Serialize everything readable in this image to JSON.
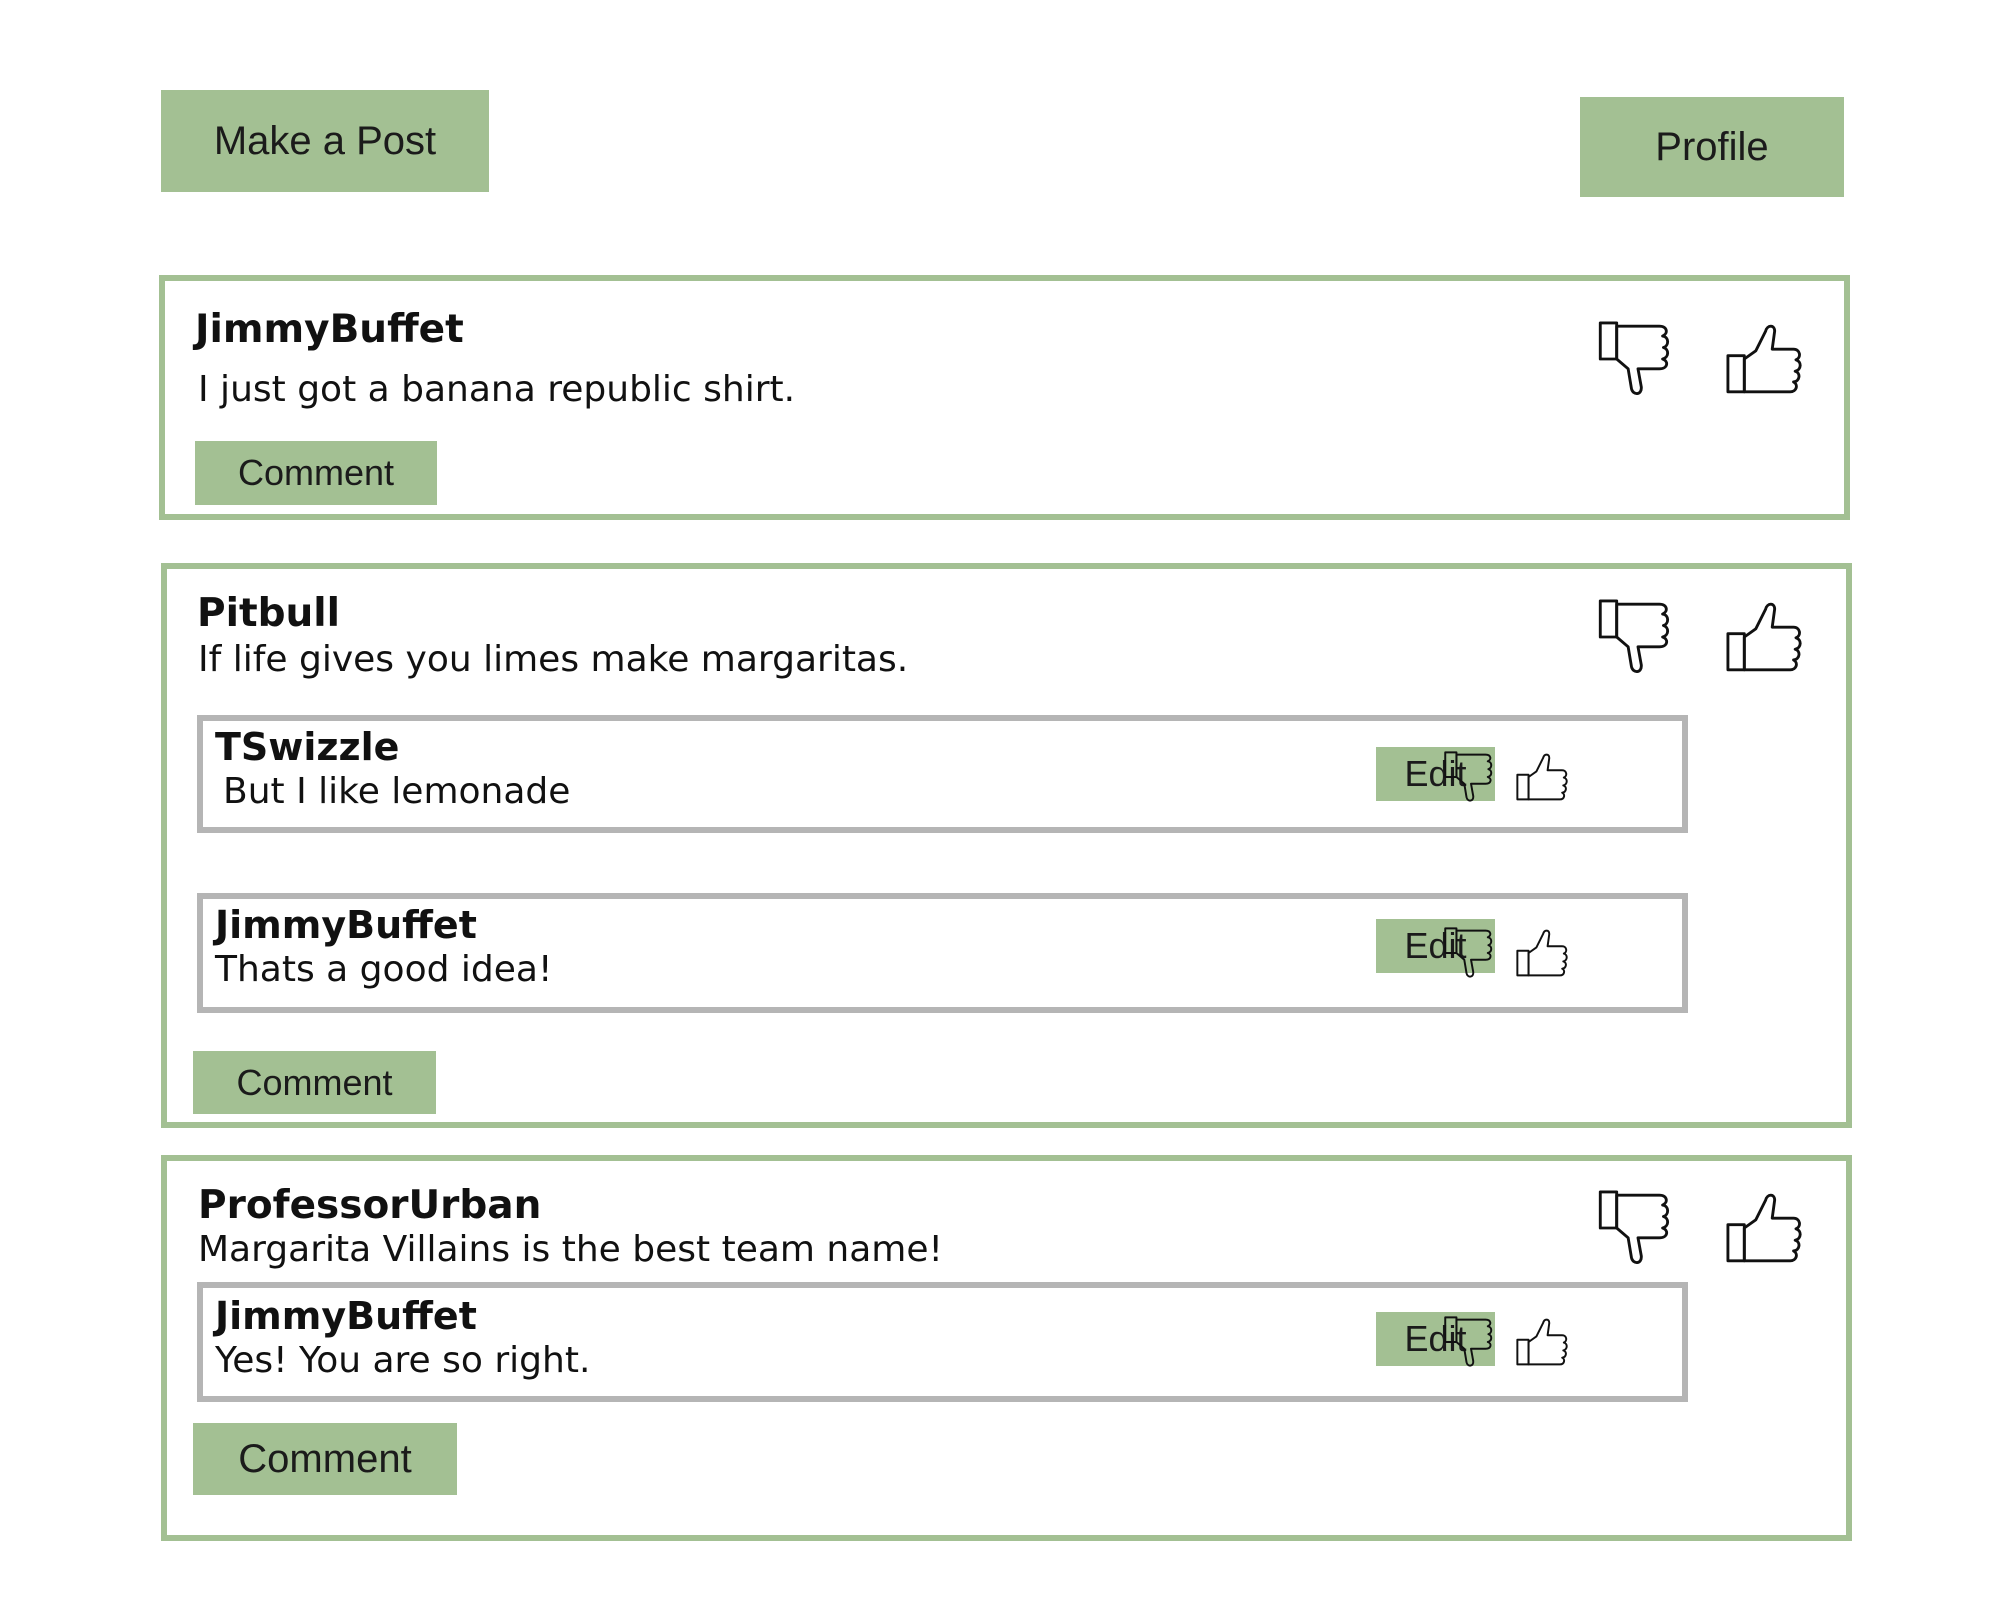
{
  "header": {
    "make_post_label": "Make a Post",
    "profile_label": "Profile"
  },
  "posts": [
    {
      "author": "JimmyBuffet",
      "text": "I just got a banana republic shirt.",
      "comment_label": "Comment",
      "comments": []
    },
    {
      "author": "Pitbull",
      "text": "If life gives you limes make margaritas.",
      "comment_label": "Comment",
      "comments": [
        {
          "author": "TSwizzle",
          "text": "But I like lemonade",
          "edit_label": "Edit"
        },
        {
          "author": "JimmyBuffet",
          "text": "Thats a good idea!",
          "edit_label": "Edit"
        }
      ]
    },
    {
      "author": "ProfessorUrban",
      "text": "Margarita Villains is the best team name!",
      "comment_label": "Comment",
      "comments": [
        {
          "author": "JimmyBuffet",
          "text": "Yes! You are so right.",
          "edit_label": "Edit"
        }
      ]
    }
  ],
  "icons": {
    "like": "thumbs-up-icon",
    "dislike": "thumbs-down-icon"
  },
  "colors": {
    "accent_green": "#a3c093",
    "comment_border": "#b5b5b5"
  }
}
